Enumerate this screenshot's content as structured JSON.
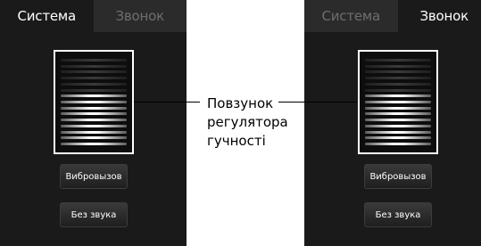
{
  "left_screen": {
    "tabs": [
      {
        "label": "Система",
        "active": true
      },
      {
        "label": "Звонок",
        "active": false
      }
    ],
    "slider": {
      "total_levels": 15,
      "active_levels": 9
    },
    "buttons": {
      "vibrate": "Вибровызов",
      "mute": "Без звука"
    }
  },
  "right_screen": {
    "tabs": [
      {
        "label": "Система",
        "active": false
      },
      {
        "label": "Звонок",
        "active": true
      }
    ],
    "slider": {
      "total_levels": 15,
      "active_levels": 9
    },
    "buttons": {
      "vibrate": "Вибровызов",
      "mute": "Без звука"
    }
  },
  "callout": {
    "lines": [
      "Повзунок",
      "регулятора",
      "гучності"
    ]
  },
  "colors": {
    "screen_background": "#1a1a1a",
    "inactive_tab_background": "#2b2b2b",
    "inactive_tab_text": "#6e6e6e",
    "slider_border": "#ffffff"
  }
}
